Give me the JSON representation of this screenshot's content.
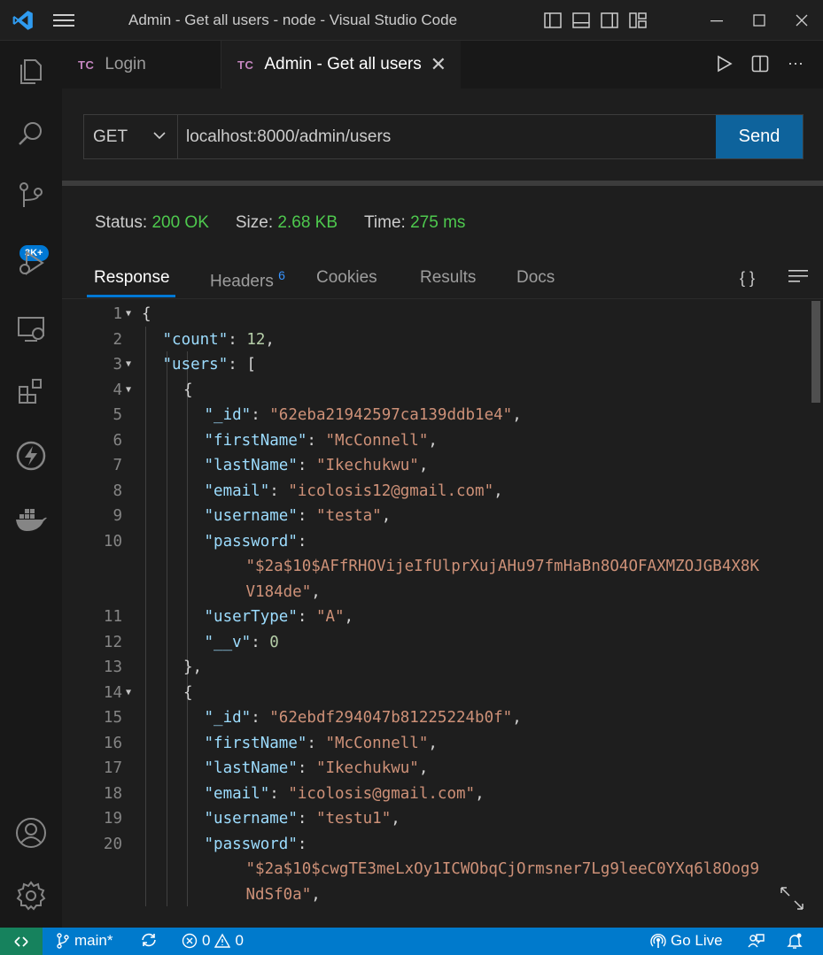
{
  "window": {
    "title": "Admin - Get all users - node - Visual Studio Code"
  },
  "activity": {
    "badge": "3K+"
  },
  "tabs": [
    {
      "prefix": "TC",
      "label": "Login"
    },
    {
      "prefix": "TC",
      "label": "Admin - Get all users"
    }
  ],
  "request": {
    "method": "GET",
    "url": "localhost:8000/admin/users",
    "send_label": "Send"
  },
  "status": {
    "status_label": "Status:",
    "status_value": "200 OK",
    "size_label": "Size:",
    "size_value": "2.68 KB",
    "time_label": "Time:",
    "time_value": "275 ms"
  },
  "response_tabs": {
    "response": "Response",
    "headers": "Headers",
    "headers_count": "6",
    "cookies": "Cookies",
    "results": "Results",
    "docs": "Docs",
    "braces": "{ }"
  },
  "json_lines": [
    {
      "num": "1",
      "fold": true,
      "indent": 0,
      "parts": [
        [
          "p",
          "{"
        ]
      ]
    },
    {
      "num": "2",
      "indent": 1,
      "parts": [
        [
          "k",
          "\"count\""
        ],
        [
          "p",
          ": "
        ],
        [
          "n",
          "12"
        ],
        [
          "p",
          ","
        ]
      ]
    },
    {
      "num": "3",
      "fold": true,
      "indent": 1,
      "parts": [
        [
          "k",
          "\"users\""
        ],
        [
          "p",
          ": ["
        ]
      ]
    },
    {
      "num": "4",
      "fold": true,
      "indent": 2,
      "parts": [
        [
          "p",
          "{"
        ]
      ]
    },
    {
      "num": "5",
      "indent": 3,
      "parts": [
        [
          "k",
          "\"_id\""
        ],
        [
          "p",
          ": "
        ],
        [
          "s",
          "\"62eba21942597ca139ddb1e4\""
        ],
        [
          "p",
          ","
        ]
      ]
    },
    {
      "num": "6",
      "indent": 3,
      "parts": [
        [
          "k",
          "\"firstName\""
        ],
        [
          "p",
          ": "
        ],
        [
          "s",
          "\"McConnell\""
        ],
        [
          "p",
          ","
        ]
      ]
    },
    {
      "num": "7",
      "indent": 3,
      "parts": [
        [
          "k",
          "\"lastName\""
        ],
        [
          "p",
          ": "
        ],
        [
          "s",
          "\"Ikechukwu\""
        ],
        [
          "p",
          ","
        ]
      ]
    },
    {
      "num": "8",
      "indent": 3,
      "parts": [
        [
          "k",
          "\"email\""
        ],
        [
          "p",
          ": "
        ],
        [
          "s",
          "\"icolosis12@gmail.com\""
        ],
        [
          "p",
          ","
        ]
      ]
    },
    {
      "num": "9",
      "indent": 3,
      "parts": [
        [
          "k",
          "\"username\""
        ],
        [
          "p",
          ": "
        ],
        [
          "s",
          "\"testa\""
        ],
        [
          "p",
          ","
        ]
      ]
    },
    {
      "num": "10",
      "indent": 3,
      "parts": [
        [
          "k",
          "\"password\""
        ],
        [
          "p",
          ":"
        ]
      ]
    },
    {
      "num": "",
      "indent": 5,
      "parts": [
        [
          "s",
          "\"$2a$10$AFfRHOVijeIfUlprXujAHu97fmHaBn8O4OFAXMZOJGB4X8K"
        ]
      ]
    },
    {
      "num": "",
      "indent": 5,
      "parts": [
        [
          "s",
          "V184de\""
        ],
        [
          "p",
          ","
        ]
      ]
    },
    {
      "num": "11",
      "indent": 3,
      "parts": [
        [
          "k",
          "\"userType\""
        ],
        [
          "p",
          ": "
        ],
        [
          "s",
          "\"A\""
        ],
        [
          "p",
          ","
        ]
      ]
    },
    {
      "num": "12",
      "indent": 3,
      "parts": [
        [
          "k",
          "\"__v\""
        ],
        [
          "p",
          ": "
        ],
        [
          "n",
          "0"
        ]
      ]
    },
    {
      "num": "13",
      "indent": 2,
      "parts": [
        [
          "p",
          "},"
        ]
      ]
    },
    {
      "num": "14",
      "fold": true,
      "indent": 2,
      "parts": [
        [
          "p",
          "{"
        ]
      ]
    },
    {
      "num": "15",
      "indent": 3,
      "parts": [
        [
          "k",
          "\"_id\""
        ],
        [
          "p",
          ": "
        ],
        [
          "s",
          "\"62ebdf294047b81225224b0f\""
        ],
        [
          "p",
          ","
        ]
      ]
    },
    {
      "num": "16",
      "indent": 3,
      "parts": [
        [
          "k",
          "\"firstName\""
        ],
        [
          "p",
          ": "
        ],
        [
          "s",
          "\"McConnell\""
        ],
        [
          "p",
          ","
        ]
      ]
    },
    {
      "num": "17",
      "indent": 3,
      "parts": [
        [
          "k",
          "\"lastName\""
        ],
        [
          "p",
          ": "
        ],
        [
          "s",
          "\"Ikechukwu\""
        ],
        [
          "p",
          ","
        ]
      ]
    },
    {
      "num": "18",
      "indent": 3,
      "parts": [
        [
          "k",
          "\"email\""
        ],
        [
          "p",
          ": "
        ],
        [
          "s",
          "\"icolosis@gmail.com\""
        ],
        [
          "p",
          ","
        ]
      ]
    },
    {
      "num": "19",
      "indent": 3,
      "parts": [
        [
          "k",
          "\"username\""
        ],
        [
          "p",
          ": "
        ],
        [
          "s",
          "\"testu1\""
        ],
        [
          "p",
          ","
        ]
      ]
    },
    {
      "num": "20",
      "indent": 3,
      "parts": [
        [
          "k",
          "\"password\""
        ],
        [
          "p",
          ":"
        ]
      ]
    },
    {
      "num": "",
      "indent": 5,
      "parts": [
        [
          "s",
          "\"$2a$10$cwgTE3meLxOy1ICWObqCjOrmsner7Lg9leeC0YXq6l8Oog9"
        ]
      ]
    },
    {
      "num": "",
      "indent": 5,
      "parts": [
        [
          "s",
          "NdSf0a\""
        ],
        [
          "p",
          ","
        ]
      ]
    }
  ],
  "statusbar": {
    "branch": "main*",
    "errors": "0",
    "warnings": "0",
    "golive": "Go Live"
  },
  "colors": {
    "accent": "#007acc",
    "status_ok": "#4ec94e",
    "send": "#0e639c"
  }
}
